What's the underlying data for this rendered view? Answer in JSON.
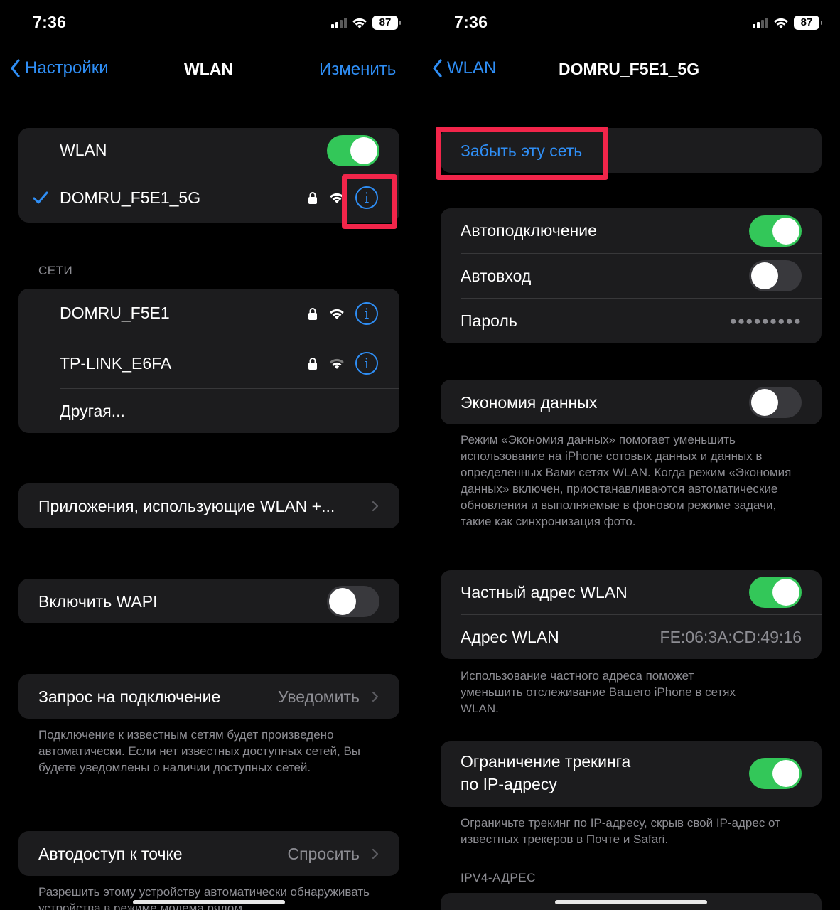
{
  "left": {
    "status": {
      "time": "7:36",
      "battery": "87"
    },
    "nav": {
      "back": "Настройки",
      "title": "WLAN",
      "edit": "Изменить"
    },
    "wlan": {
      "label": "WLAN",
      "toggle_on": true,
      "connected": {
        "name": "DOMRU_F5E1_5G",
        "locked": true
      }
    },
    "networks_header": "СЕТИ",
    "networks": [
      {
        "name": "DOMRU_F5E1",
        "locked": true
      },
      {
        "name": "TP-LINK_E6FA",
        "locked": true
      }
    ],
    "other": "Другая...",
    "apps_row": "Приложения, использующие WLAN +...",
    "wapi": {
      "label": "Включить WAPI",
      "toggle_on": false
    },
    "ask_join": {
      "label": "Запрос на подключение",
      "value": "Уведомить"
    },
    "ask_join_footer": "Подключение к известным сетям будет произведено автоматически. Если нет известных доступных сетей, Вы будете уведомлены о наличии доступных сетей.",
    "hotspot": {
      "label": "Автодоступ к точке",
      "value": "Спросить"
    },
    "hotspot_footer": "Разрешить этому устройству автоматически обнаруживать устройства в режиме модема рядом"
  },
  "right": {
    "status": {
      "time": "7:36",
      "battery": "87"
    },
    "nav": {
      "back": "WLAN",
      "title": "DOMRU_F5E1_5G"
    },
    "forget": "Забыть эту сеть",
    "auto_join": {
      "label": "Автоподключение",
      "toggle_on": true
    },
    "auto_login": {
      "label": "Автовход",
      "toggle_on": false
    },
    "password": {
      "label": "Пароль",
      "value": "●●●●●●●●●"
    },
    "low_data": {
      "label": "Экономия данных",
      "toggle_on": false
    },
    "low_data_footer": "Режим «Экономия данных» помогает уменьшить использование на iPhone сотовых данных и данных в определенных Вами сетях WLAN. Когда режим «Экономия данных» включен, приостанавливаются автоматические обновления и выполняемые в фоновом режиме задачи, такие как синхронизация фото.",
    "private_addr": {
      "label": "Частный адрес WLAN",
      "toggle_on": true
    },
    "wlan_addr": {
      "label": "Адрес WLAN",
      "value": "FE:06:3A:CD:49:16"
    },
    "private_footer": "Использование частного адреса поможет уменьшить отслеживание Вашего iPhone в сетях WLAN.",
    "tracking": {
      "label_line1": "Ограничение трекинга",
      "label_line2": "по IP-адресу",
      "toggle_on": true
    },
    "tracking_footer": "Ограничьте трекинг по IP-адресу, скрыв свой IP-адрес от известных трекеров в Почте и Safari.",
    "ipv4_header": "IPV4-АДРЕС"
  },
  "colors": {
    "accent": "#2f8ef5",
    "toggle_on": "#33c759",
    "highlight": "#f2254a",
    "cell": "#1c1c1e"
  }
}
